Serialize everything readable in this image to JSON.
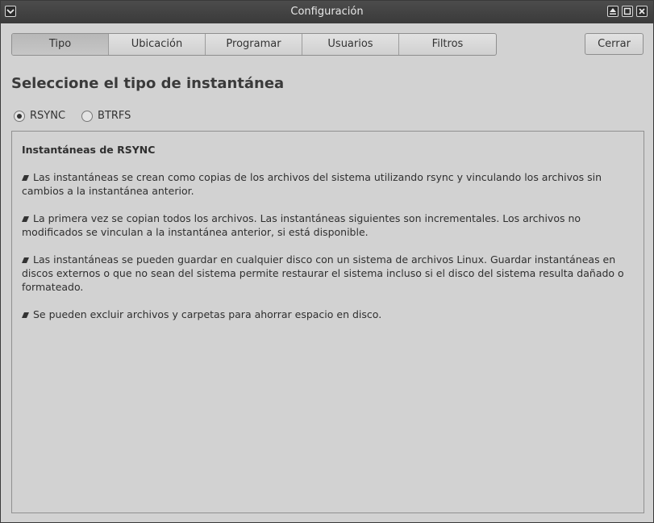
{
  "window": {
    "title": "Configuración"
  },
  "tabs": [
    {
      "label": "Tipo",
      "active": true
    },
    {
      "label": "Ubicación",
      "active": false
    },
    {
      "label": "Programar",
      "active": false
    },
    {
      "label": "Usuarios",
      "active": false
    },
    {
      "label": "Filtros",
      "active": false
    }
  ],
  "close_button": "Cerrar",
  "heading": "Seleccione el tipo de instantánea",
  "snapshot_types": [
    {
      "label": "RSYNC",
      "selected": true
    },
    {
      "label": "BTRFS",
      "selected": false
    }
  ],
  "description": {
    "title": "Instantáneas de RSYNC",
    "bullets": [
      "Las instantáneas se crean como copias de los archivos del sistema utilizando rsync y vinculando los archivos sin cambios a la instantánea anterior.",
      "La primera vez se copian todos los archivos. Las instantáneas siguientes son incrementales. Los archivos no modificados se vinculan a la instantánea anterior, si está disponible.",
      "Las instantáneas se pueden guardar en cualquier disco con un sistema de archivos Linux. Guardar instantáneas en discos externos o que no sean del sistema permite restaurar el sistema incluso si el disco del sistema resulta dañado o formateado.",
      "Se pueden excluir archivos y carpetas para ahorrar espacio en disco."
    ]
  },
  "icons": {
    "menu": "chevron-down-icon",
    "shade": "eject-icon",
    "maximize": "maximize-icon",
    "close": "close-icon",
    "bullet": "parallelogram-bullet-icon"
  }
}
